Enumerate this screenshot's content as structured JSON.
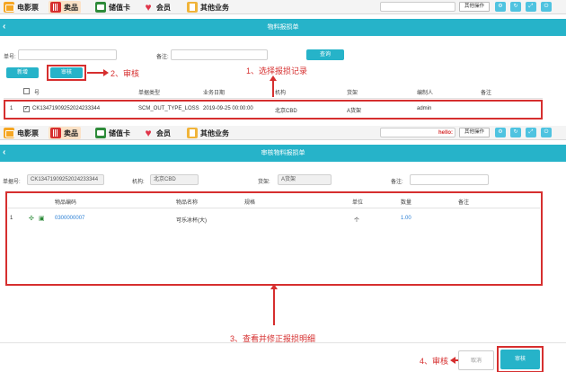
{
  "nav": {
    "tabs": [
      {
        "label": "电影票",
        "icon": "film-icon"
      },
      {
        "label": "卖品",
        "icon": "popcorn-icon"
      },
      {
        "label": "储值卡",
        "icon": "card-icon"
      },
      {
        "label": "会员",
        "icon": "heart-icon"
      },
      {
        "label": "其他业务",
        "icon": "other-icon"
      }
    ],
    "other_ops": "其他操作",
    "hello": "hello:"
  },
  "list_page": {
    "title": "物料报损单",
    "filters": {
      "order_no_label": "单号:",
      "remark_label": "备注:",
      "query": "查询"
    },
    "buttons": {
      "add": "新增",
      "audit": "审核"
    },
    "columns": [
      "号",
      "单据类型",
      "业务日期",
      "机构",
      "货架",
      "编制人",
      "备注"
    ],
    "rows": [
      {
        "idx": "1",
        "no": "CK13471909252024233344",
        "type": "SCM_OUT_TYPE_LOSS",
        "date": "2019-09-25 00:00:00",
        "org": "北京CBD",
        "shelf": "A货架",
        "maker": "admin",
        "remark": ""
      }
    ]
  },
  "annotations": {
    "step1": "1、选择报损记录",
    "step2": "2、审核",
    "step3": "3、查看并修正报损明细",
    "step4": "4、审核"
  },
  "audit_page": {
    "title": "审核物料报损单",
    "fields": {
      "doc_no_label": "单据号:",
      "doc_no": "CK13471909252024233344",
      "org_label": "机构:",
      "org": "北京CBD",
      "shelf_label": "货架:",
      "shelf": "A货架",
      "remark_label": "备注:"
    },
    "columns": [
      "物品编码",
      "物品名称",
      "规格",
      "单位",
      "数量",
      "备注"
    ],
    "rows": [
      {
        "idx": "1",
        "code": "0300000007",
        "name": "可乐冰杯(大)",
        "spec": "",
        "unit": "个",
        "qty": "1.00",
        "remark": ""
      }
    ],
    "buttons": {
      "cancel": "取消",
      "audit": "审核"
    }
  },
  "colors": {
    "accent": "#26b3c9",
    "annotation": "#d62f2f",
    "link": "#2a7fd4"
  }
}
